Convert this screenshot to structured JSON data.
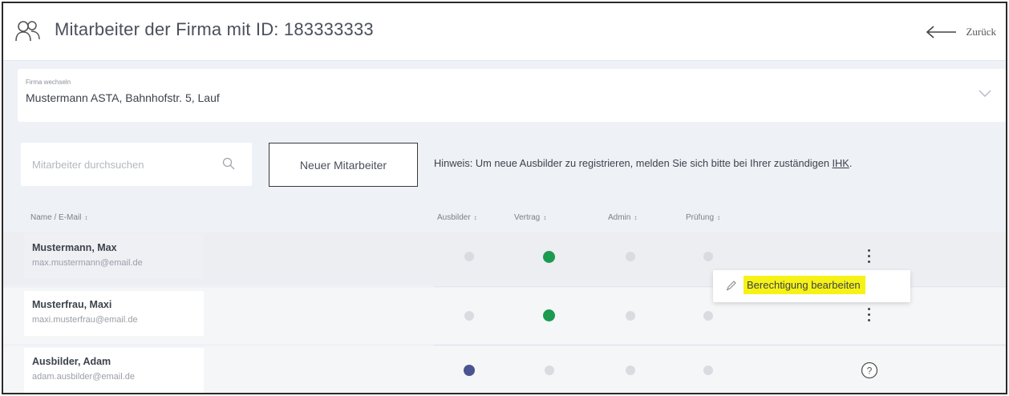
{
  "header": {
    "title": "Mitarbeiter der Firma mit ID: 183333333",
    "back_label": "Zurück",
    "icon": "users-icon"
  },
  "company_select": {
    "label": "Firma wechseln",
    "value": "Mustermann ASTA, Bahnhofstr. 5, Lauf"
  },
  "search": {
    "placeholder": "Mitarbeiter durchsuchen"
  },
  "new_employee_button": "Neuer Mitarbeiter",
  "hint": {
    "text": "Hinweis: Um neue Ausbilder zu registrieren, melden Sie sich bitte bei Ihrer zuständigen ",
    "link": "IHK",
    "suffix": "."
  },
  "columns": {
    "name": "Name / E-Mail",
    "ausbilder": "Ausbilder",
    "vertrag": "Vertrag",
    "admin": "Admin",
    "pruefung": "Prüfung",
    "sort_glyph": "↕"
  },
  "rows": [
    {
      "name": "Mustermann, Max",
      "email": "max.mustermann@email.de",
      "ausbilder": false,
      "vertrag": true,
      "admin": false,
      "pruefung": false
    },
    {
      "name": "Musterfrau, Maxi",
      "email": "maxi.musterfrau@email.de",
      "ausbilder": false,
      "vertrag": true,
      "admin": false,
      "pruefung": false
    },
    {
      "name": "Ausbilder, Adam",
      "email": "adam.ausbilder@email.de",
      "ausbilder": true,
      "vertrag": false,
      "admin": false,
      "pruefung": false
    }
  ],
  "context_menu": {
    "edit_permission": "Berechtigung bearbeiten"
  },
  "help_glyph": "?",
  "colors": {
    "active_green": "#1b9a50",
    "active_blue": "#4a5490",
    "inactive": "#d9dbe0",
    "highlight": "#f7f215"
  }
}
